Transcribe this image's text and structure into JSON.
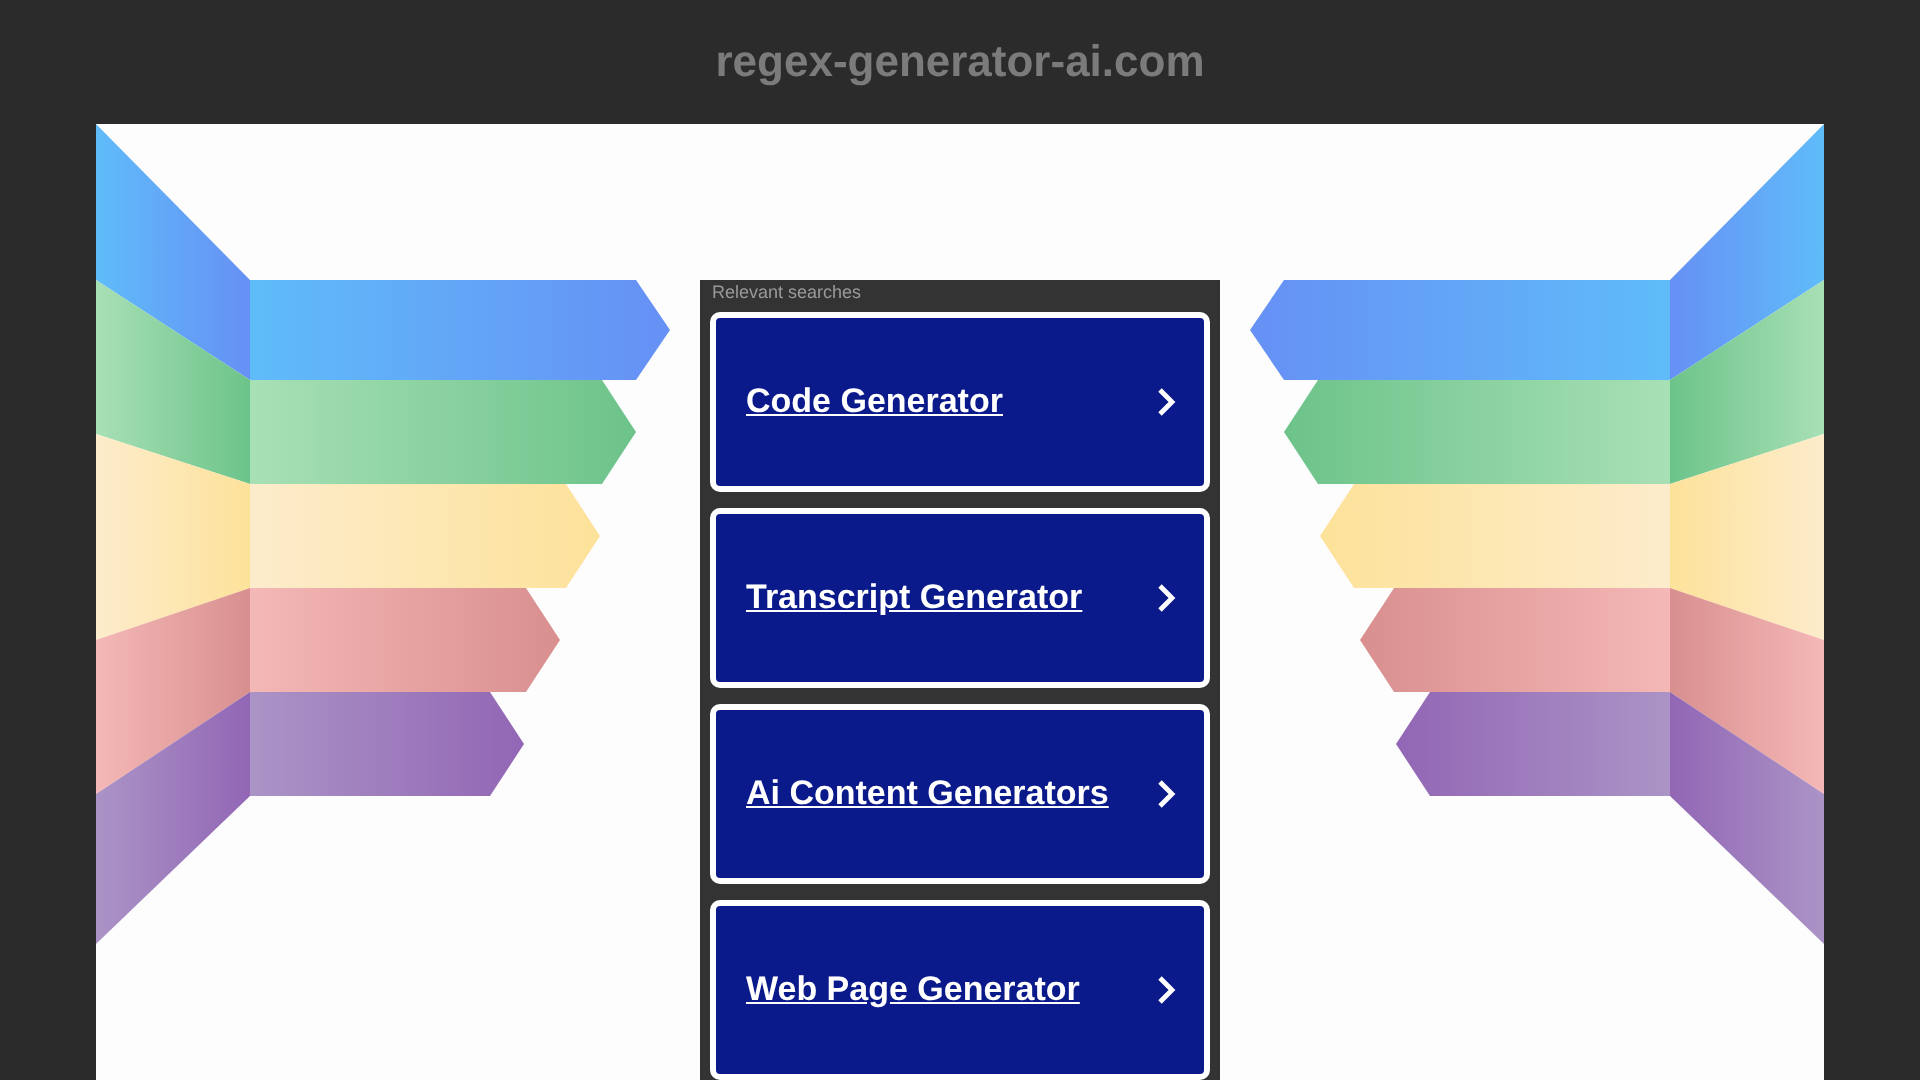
{
  "site_title": "regex-generator-ai.com",
  "panel": {
    "heading": "Relevant searches",
    "links": [
      {
        "label": "Code Generator"
      },
      {
        "label": "Transcript Generator"
      },
      {
        "label": "Ai Content Generators"
      },
      {
        "label": "Web Page Generator"
      }
    ]
  }
}
